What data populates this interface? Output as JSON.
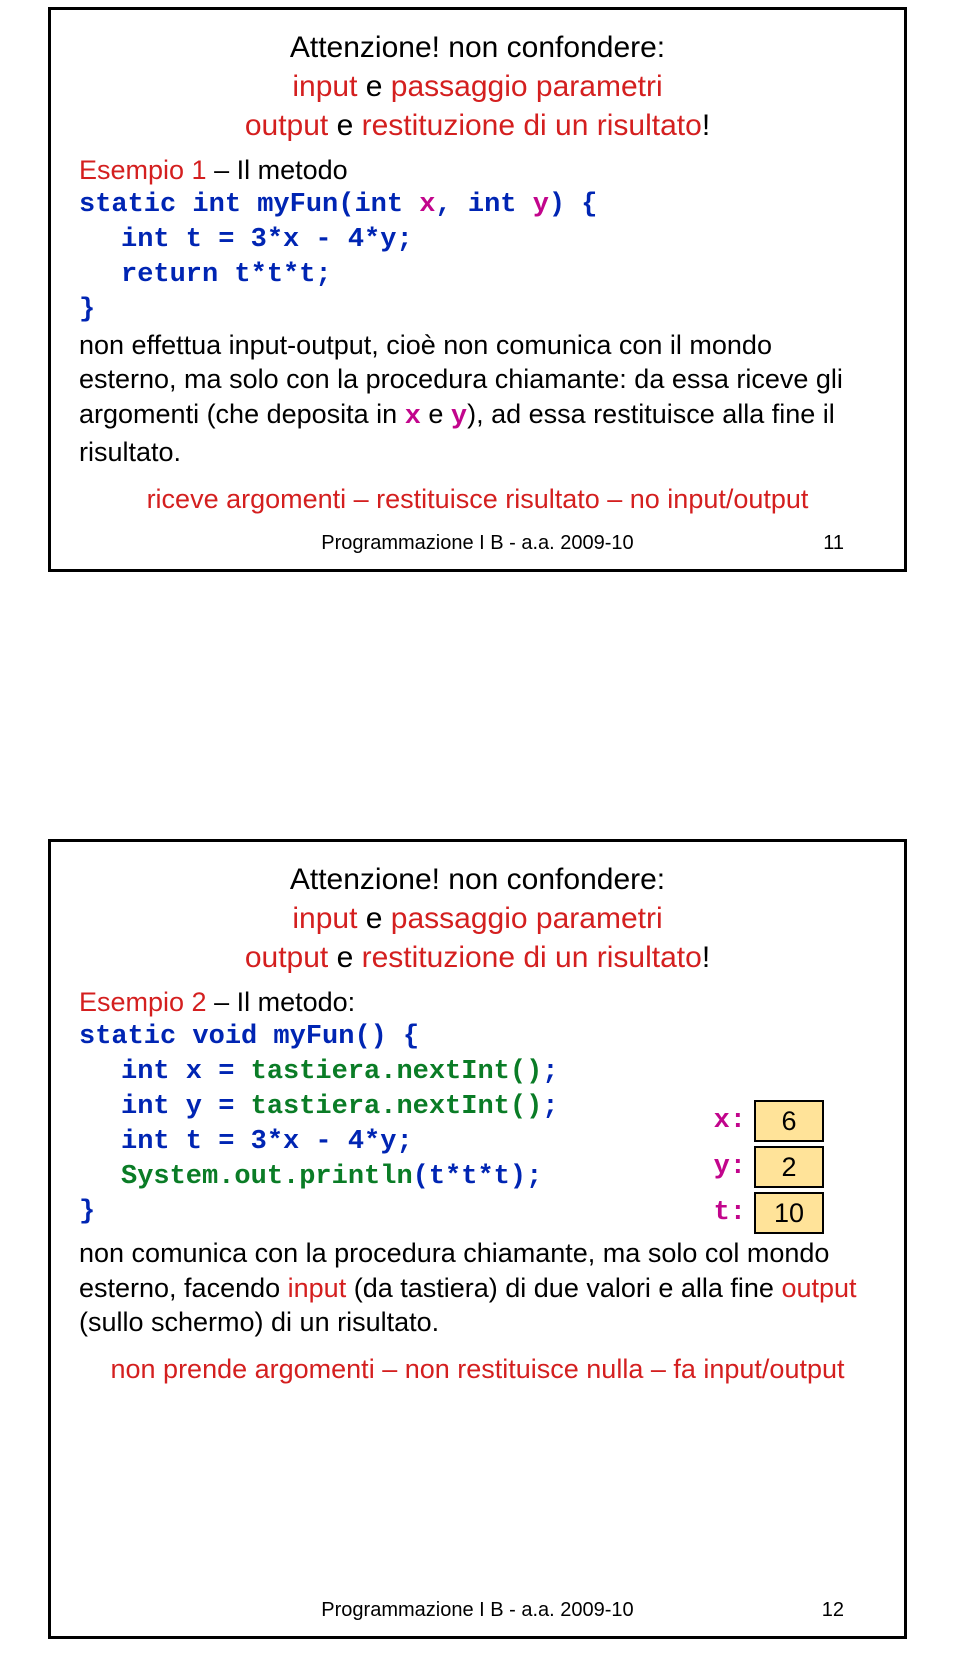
{
  "slide1": {
    "title_line1": "Attenzione! non confondere:",
    "title_line2a": "input",
    "title_line2b": " e ",
    "title_line2c": "passaggio parametri",
    "title_line3a": "output",
    "title_line3b": " e ",
    "title_line3c": "restituzione di un risultato",
    "title_line3d": "!",
    "ex_label": "Esempio 1",
    "ex_text": " – Il metodo",
    "code_sig_a": "static int myFun(int ",
    "code_sig_x": "x",
    "code_sig_b": ", int ",
    "code_sig_y": "y",
    "code_sig_c": ") {",
    "code_body1": "int t = 3*x - 4*y;",
    "code_body2": "return t*t*t;",
    "code_close": "}",
    "body_a": "non effettua input-output, cioè non comunica con il mondo esterno, ma solo con la procedura chiamante: da essa riceve gli argomenti (che deposita in ",
    "body_x": "x",
    "body_mid": " e ",
    "body_y": "y",
    "body_b": "), ad essa restituisce alla fine il risultato.",
    "summary": "riceve argomenti – restituisce risultato – no input/output",
    "footer": "Programmazione I B - a.a. 2009-10",
    "page": "11"
  },
  "slide2": {
    "title_line1": "Attenzione! non confondere:",
    "title_line2a": "input",
    "title_line2b": " e ",
    "title_line2c": "passaggio parametri",
    "title_line3a": "output",
    "title_line3b": " e ",
    "title_line3c": "restituzione di un risultato",
    "title_line3d": "!",
    "ex_label": "Esempio 2",
    "ex_text": " – Il metodo:",
    "code_sig": "static void myFun() {",
    "code_l2a": "int x = ",
    "code_l2b": "tastiera.nextInt()",
    "code_l2c": ";",
    "code_l3a": "int y = ",
    "code_l3b": "tastiera.nextInt()",
    "code_l3c": ";",
    "code_l4": "int t = 3*x - 4*y;",
    "code_l5a": "System.out.println",
    "code_l5b": "(t*t*t)",
    "code_l5c": ";",
    "code_close": "}",
    "body_a": "non comunica con la procedura chiamante, ma solo col mondo esterno, facendo ",
    "body_input": "input",
    "body_b": " (da tastiera) di due valori e alla fine ",
    "body_output": "output",
    "body_c": " (sullo schermo) di un risultato.",
    "summary": "non prende argomenti – non restituisce nulla – fa input/output",
    "vars": {
      "x_label": "x:",
      "x_val": "6",
      "y_label": "y:",
      "y_val": "2",
      "t_label": "t:",
      "t_val": "10"
    },
    "footer": "Programmazione I B - a.a. 2009-10",
    "page": "12"
  }
}
